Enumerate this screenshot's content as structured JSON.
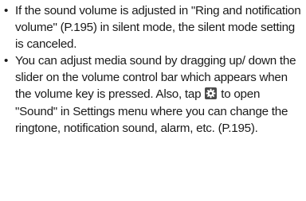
{
  "bullets": [
    {
      "mark": "•",
      "text": "If the sound volume is adjusted in \"Ring and notification volume\" (P.195) in silent mode, the silent mode setting is canceled."
    },
    {
      "mark": "•",
      "text_before_icon": "You can adjust media sound by dragging up/ down the slider on the volume control bar which appears when the volume key is pressed. Also, tap ",
      "icon": "settings-gear-icon",
      "text_after_icon": " to open \"Sound\" in Settings menu where you can change the ringtone, notification sound, alarm, etc. (P.195)."
    }
  ],
  "colors": {
    "text": "#1a1a1a",
    "icon_background": "#4a4a4a",
    "icon_foreground": "#ffffff"
  }
}
